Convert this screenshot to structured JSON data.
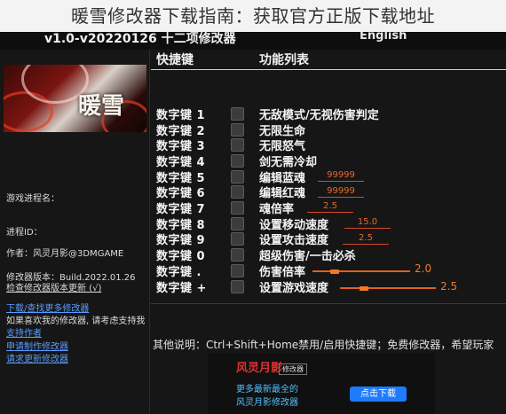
{
  "page_title": "暖雪修改器下载指南：获取官方正版下载地址",
  "window": {
    "version_title": "v1.0-v20220126 十二项修改器",
    "language": "English"
  },
  "sidebar": {
    "cover_logo": "暖雪",
    "game_process_label": "游戏进程名：",
    "process_id_label": "进程ID：",
    "author": "作者：风灵月影@3DMGAME",
    "trainer_version": "修改器版本：Build.2022.01.26",
    "check_update": "检查修改器版本更新 (√)",
    "links": [
      "下载/查找更多修改器",
      "如果喜欢我的修改器, 请考虑支持我",
      "支持作者",
      "申请制作修改器",
      "请求更新修改器"
    ]
  },
  "headers": {
    "hotkey": "快捷键",
    "function": "功能列表"
  },
  "rows": [
    {
      "key": "数字键 1",
      "label": "无敌模式/无视伤害判定"
    },
    {
      "key": "数字键 2",
      "label": "无限生命"
    },
    {
      "key": "数字键 3",
      "label": "无限怒气"
    },
    {
      "key": "数字键 4",
      "label": "剑无需冷却"
    },
    {
      "key": "数字键 5",
      "label": "编辑蓝魂",
      "value": "99999"
    },
    {
      "key": "数字键 6",
      "label": "编辑红魂",
      "value": "99999"
    },
    {
      "key": "数字键 7",
      "label": "魂倍率",
      "value": "2.5"
    },
    {
      "key": "数字键 8",
      "label": "设置移动速度",
      "value": "15.0"
    },
    {
      "key": "数字键 9",
      "label": "设置攻击速度",
      "value": "2.5"
    },
    {
      "key": "数字键 0",
      "label": "超级伤害/一击必杀"
    },
    {
      "key": "数字键 .",
      "label": "伤害倍率",
      "value": "2.0"
    },
    {
      "key": "数字键 +",
      "label": "设置游戏速度",
      "value": "2.5"
    }
  ],
  "footer": "其他说明：Ctrl+Shift+Home禁用/启用快捷键；免费修改器，希望玩家",
  "banner": {
    "logo": "风灵月影",
    "chip": "修改器",
    "line1": "更多最新最全的",
    "line2": "风灵月影修改器",
    "button": "点击下载"
  },
  "colors": {
    "accent": "#f07a28",
    "link": "#5a9cff",
    "background": "#161616"
  }
}
